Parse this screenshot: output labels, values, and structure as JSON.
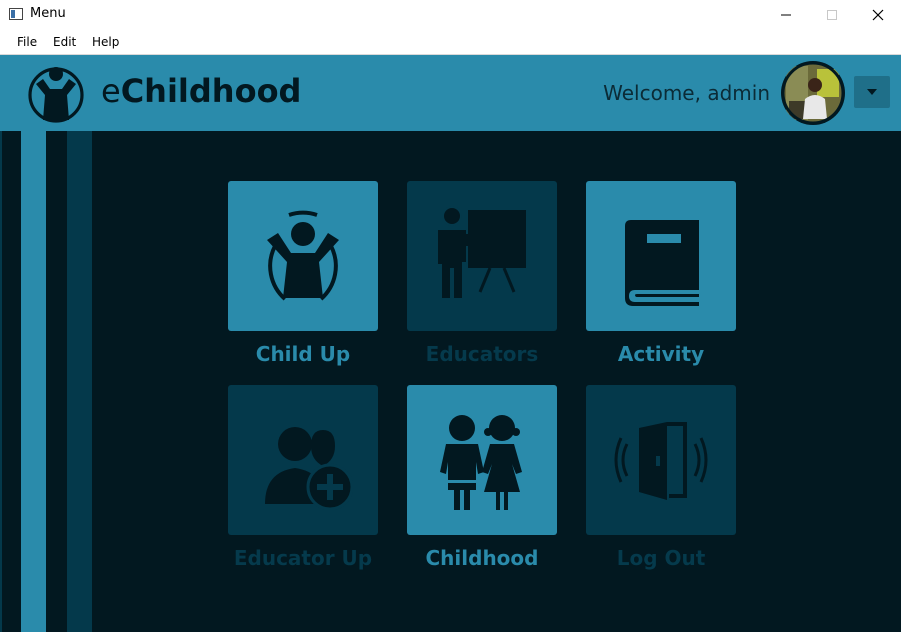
{
  "window": {
    "title": "Menu"
  },
  "menubar": {
    "items": [
      "File",
      "Edit",
      "Help"
    ]
  },
  "header": {
    "brand_prefix": "e",
    "brand_name": "Childhood",
    "welcome": "Welcome, admin"
  },
  "tiles": [
    {
      "label": "Child Up",
      "icon": "child-up-icon",
      "style": "light"
    },
    {
      "label": "Educators",
      "icon": "educator-board-icon",
      "style": "dark"
    },
    {
      "label": "Activity",
      "icon": "book-icon",
      "style": "light"
    },
    {
      "label": "Educator Up",
      "icon": "add-educator-icon",
      "style": "dark"
    },
    {
      "label": "Childhood",
      "icon": "children-icon",
      "style": "light"
    },
    {
      "label": "Log Out",
      "icon": "door-exit-icon",
      "style": "dark"
    }
  ],
  "colors": {
    "accent": "#2a8bab",
    "background": "#021820",
    "tile_dark": "#04394b",
    "icon_dark": "#021820"
  }
}
